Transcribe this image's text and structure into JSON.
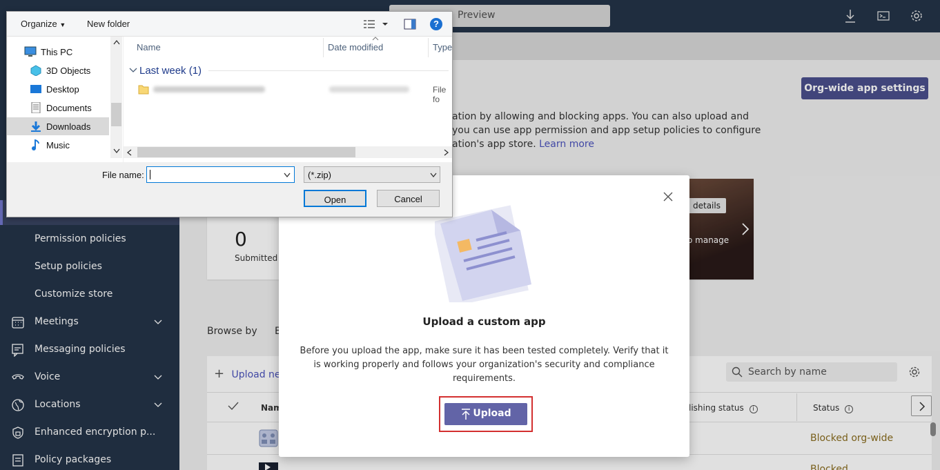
{
  "topbar": {
    "preview_label": "Preview"
  },
  "sidebar": {
    "items": [
      {
        "label": "Permission policies",
        "icon": "none",
        "has_chevron": false
      },
      {
        "label": "Setup policies",
        "icon": "none",
        "has_chevron": false
      },
      {
        "label": "Customize store",
        "icon": "none",
        "has_chevron": false
      },
      {
        "label": "Meetings",
        "icon": "calendar-icon",
        "has_chevron": true
      },
      {
        "label": "Messaging policies",
        "icon": "chat-icon",
        "has_chevron": false
      },
      {
        "label": "Voice",
        "icon": "voice-icon",
        "has_chevron": true
      },
      {
        "label": "Locations",
        "icon": "globe-icon",
        "has_chevron": true
      },
      {
        "label": "Enhanced encryption p...",
        "icon": "shield-icon",
        "has_chevron": false
      },
      {
        "label": "Policy packages",
        "icon": "package-icon",
        "has_chevron": false
      }
    ]
  },
  "main": {
    "org_wide_button": "Org-wide app settings",
    "description_lines": [
      "ation by allowing and blocking apps. You can also upload and",
      "you can use app permission and app setup policies to configure",
      "ation's app store."
    ],
    "learn_more": "Learn more",
    "summary": {
      "count": "0",
      "count_label": "Submitted c",
      "details_button": "details",
      "manage_text": "o manage"
    },
    "browse_by": "Browse by",
    "browse_letter": "E",
    "table": {
      "upload_new": "Upload new",
      "search_placeholder": "Search by name",
      "col_name": "Nam",
      "col_publishing": "lishing status",
      "col_status": "Status",
      "row1_status": "Blocked org-wide",
      "row2_partial": "Blocked"
    }
  },
  "modal": {
    "title": "Upload a custom app",
    "description": "Before you upload the app, make sure it has been tested completely. Verify that it is working properly and follows your organization's security and compliance requirements.",
    "upload_button": "Upload"
  },
  "file_dialog": {
    "organize": "Organize",
    "new_folder": "New folder",
    "tree": [
      "This PC",
      "3D Objects",
      "Desktop",
      "Documents",
      "Downloads",
      "Music"
    ],
    "selected_tree_item": "Downloads",
    "columns": {
      "name": "Name",
      "date_modified": "Date modified",
      "type": "Type"
    },
    "group_label": "Last week (1)",
    "file_type_partial": "File fo",
    "file_name_label": "File name:",
    "file_name_value": "",
    "file_type_filter": "(*.zip)",
    "open_button": "Open",
    "cancel_button": "Cancel"
  },
  "colors": {
    "accent": "#6264a7",
    "sidebar": "#243448",
    "highlight": "#d32f2f"
  }
}
